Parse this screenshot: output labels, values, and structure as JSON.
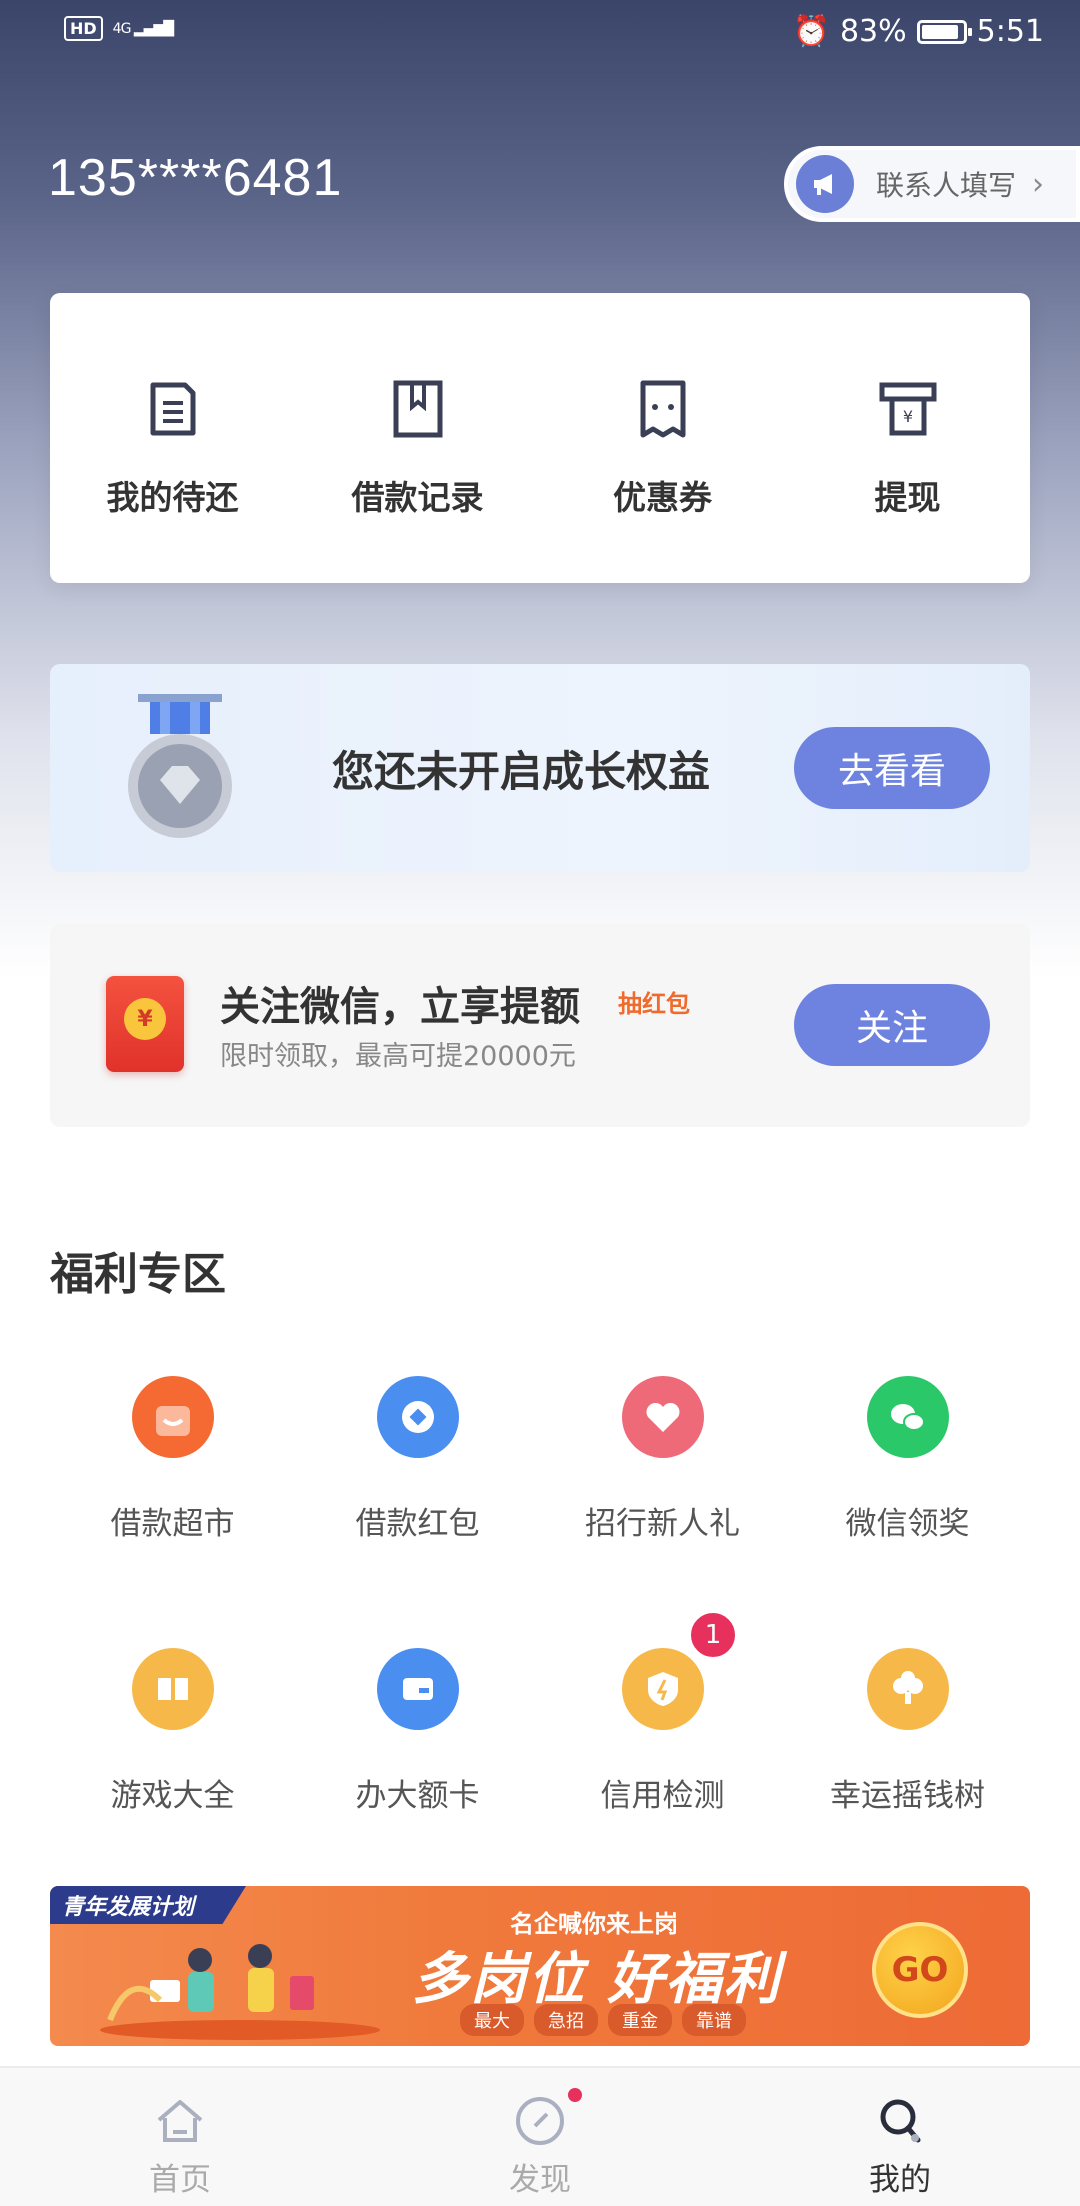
{
  "status_bar": {
    "hd": "HD",
    "network": "4G",
    "battery": "83%",
    "time": "5:51"
  },
  "header": {
    "phone": "135****6481",
    "contact_label": "联系人填写"
  },
  "quick_actions": [
    {
      "label": "我的待还",
      "icon": "document-icon"
    },
    {
      "label": "借款记录",
      "icon": "bookmark-book-icon"
    },
    {
      "label": "优惠券",
      "icon": "coupon-icon"
    },
    {
      "label": "提现",
      "icon": "withdraw-icon"
    }
  ],
  "growth": {
    "text": "您还未开启成长权益",
    "button": "去看看"
  },
  "wechat_promo": {
    "title": "关注微信，立享提额",
    "tag": "抽红包",
    "subtitle": "限时领取，最高可提20000元",
    "button": "关注",
    "coin": "¥"
  },
  "benefits": {
    "title": "福利专区",
    "row1": [
      {
        "label": "借款超市",
        "color": "#f46a32"
      },
      {
        "label": "借款红包",
        "color": "#4a8ef0"
      },
      {
        "label": "招行新人礼",
        "color": "#ef6a78"
      },
      {
        "label": "微信领奖",
        "color": "#2bc86a"
      }
    ],
    "row2": [
      {
        "label": "游戏大全",
        "color": "#f7b84a"
      },
      {
        "label": "办大额卡",
        "color": "#4a8ef0"
      },
      {
        "label": "信用检测",
        "color": "#f7b84a",
        "badge": "1"
      },
      {
        "label": "幸运摇钱树",
        "color": "#f7b84a"
      }
    ]
  },
  "banner": {
    "flag": "青年发展计划",
    "sub": "名企喊你来上岗",
    "main": "多岗位 好福利",
    "chips": [
      "最大",
      "急招",
      "重金",
      "靠谱"
    ],
    "go": "GO"
  },
  "tabbar": [
    {
      "label": "首页",
      "icon": "home-icon",
      "active": false
    },
    {
      "label": "发现",
      "icon": "compass-icon",
      "active": false
    },
    {
      "label": "我的",
      "icon": "profile-icon",
      "active": true
    }
  ]
}
